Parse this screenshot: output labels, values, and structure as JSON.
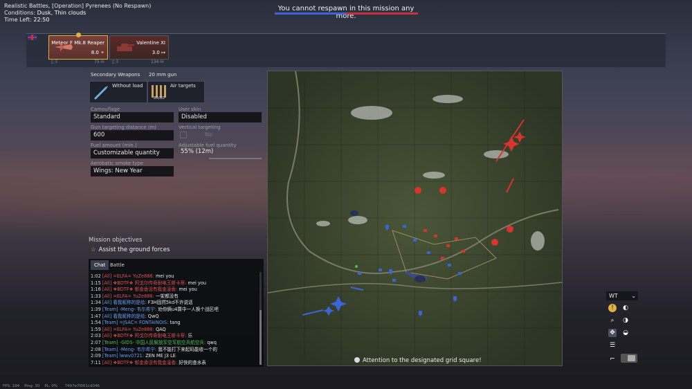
{
  "header": {
    "mode_line": "Realistic Battles, [Operation] Pyrenees (No Respawn)",
    "conditions_label": "Conditions:",
    "conditions_value": "Dusk, Thin clouds",
    "time_label": "Time Left:",
    "time_value": "22:50"
  },
  "respawn_message": "You cannot respawn in this mission any more.",
  "slots": [
    {
      "name": "Meteor F Mk.8 Reaper",
      "br": "8.0",
      "count": "3",
      "cost": "75"
    },
    {
      "name": "Valentine XI",
      "br": "3.0",
      "count": "3",
      "cost": "134"
    }
  ],
  "loadout": {
    "secondary_weapons_label": "Secondary Weapons",
    "gun_label": "20 mm gun",
    "secondary_value": "Without load",
    "gun_value": "Air targets",
    "ammo_count": "80/80"
  },
  "settings": {
    "camouflage_label": "Camouflage",
    "camouflage_value": "Standard",
    "user_skin_label": "User skin",
    "user_skin_value": "Disabled",
    "gun_distance_label": "Gun targeting distance (m)",
    "gun_distance_value": "600",
    "vertical_targeting_label": "Vertical targeting",
    "vertical_targeting_value": "No",
    "fuel_amount_label": "Fuel amount (min.)",
    "fuel_amount_value": "Customizable quantity",
    "adjustable_fuel_label": "Adjustable fuel quantity",
    "adjustable_fuel_value": "55% (12m)",
    "smoke_label": "Aerobatic smoke type",
    "smoke_value": "Wings: New Year"
  },
  "objectives": {
    "title": "Mission objectives",
    "items": [
      "Assist the ground forces"
    ]
  },
  "chat": {
    "tabs": [
      "Chat",
      "Battle"
    ],
    "lines": [
      {
        "time": "1:02",
        "channel": "[All]",
        "name": "=ELFA= YuZe886:",
        "msg": "mei you",
        "cls": "ch-all"
      },
      {
        "time": "1:15",
        "channel": "[All]",
        "name": "❖BDTF❖ 阿戈尔传奇耐电王斯卡蒂:",
        "msg": "mei you",
        "cls": "ch-all"
      },
      {
        "time": "1:16",
        "channel": "[All]",
        "name": "❖BDTF❖ 郁金香没有我金凌香:",
        "msg": "mei you",
        "cls": "ch-all"
      },
      {
        "time": "1:33",
        "channel": "[All]",
        "name": "=ELFA= YuZe886:",
        "msg": "一架都没有",
        "cls": "ch-all"
      },
      {
        "time": "1:34",
        "channel": "[All]",
        "name": "看我昵称的是给:",
        "msg": "F3H固然5kd不许说话",
        "cls": "ch-team"
      },
      {
        "time": "1:39",
        "channel": "[Team]",
        "name": "-Meng- 韦尔希宁:",
        "msg": "劝你俩u4算中一人换个战区吧",
        "cls": "ch-team"
      },
      {
        "time": "1:47",
        "channel": "[All]",
        "name": "看我昵称的是给:",
        "msg": "QwQ",
        "cls": "ch-team"
      },
      {
        "time": "1:54",
        "channel": "[Team]",
        "name": "=JSAC= FONTAINOIS:",
        "msg": "tang",
        "cls": "ch-team"
      },
      {
        "time": "1:59",
        "channel": "[All]",
        "name": "=ELFA= YuZe886:",
        "msg": "QAQ",
        "cls": "ch-all"
      },
      {
        "time": "2:03",
        "channel": "[All]",
        "name": "❖BDTF❖ 阿戈尔传奇耐电王斯卡蒂:",
        "msg": "乐",
        "cls": "ch-all"
      },
      {
        "time": "2:07",
        "channel": "[Team]",
        "name": "-GIDS- 中国人民解放军空军航空兵航空兵:",
        "msg": "qwq",
        "cls": "ch-green"
      },
      {
        "time": "2:08",
        "channel": "[Team]",
        "name": "-Meng- 韦尔希宁:",
        "msg": "我不能打下来起码能收一个的",
        "cls": "ch-team"
      },
      {
        "time": "2:09",
        "channel": "[Team]",
        "name": "lwwv0721:",
        "msg": "ZEN ME J3 LE",
        "cls": "ch-team"
      },
      {
        "time": "7:11",
        "channel": "[All]",
        "name": "❖BDTF❖ 郁金香没有我金凌香:",
        "msg": "好快的查水表",
        "cls": "ch-all"
      }
    ]
  },
  "map": {
    "hint": "Attention to the designated grid square!"
  },
  "controls": {
    "mode_value": "WT"
  },
  "footer": {
    "fps": "FPS: 194",
    "ping": "Ping: 30",
    "pl": "PL: 0%",
    "session": "7497e7f001cd046"
  },
  "colors": {
    "ally": "#3b64d8",
    "enemy": "#d8332c",
    "gold": "#e0b040"
  }
}
